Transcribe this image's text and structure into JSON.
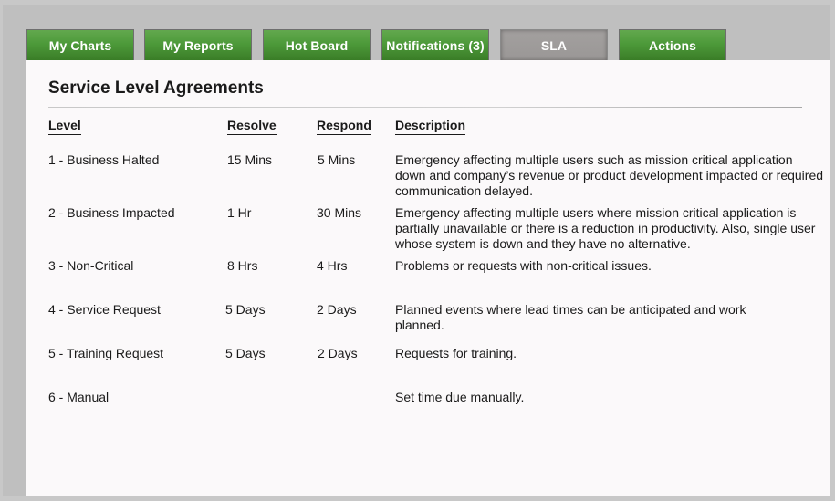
{
  "tabs": [
    {
      "label": "My Charts",
      "active": false
    },
    {
      "label": "My Reports",
      "active": false
    },
    {
      "label": "Hot Board",
      "active": false
    },
    {
      "label": "Notifications (3)",
      "active": false
    },
    {
      "label": "SLA",
      "active": true
    },
    {
      "label": "Actions",
      "active": false
    }
  ],
  "page": {
    "title": "Service Level Agreements"
  },
  "table": {
    "headers": {
      "level": "Level",
      "resolve": "Resolve",
      "respond": "Respond",
      "description": "Description"
    },
    "rows": [
      {
        "level": "1 - Business Halted",
        "resolve": "15 Mins",
        "respond": "5 Mins",
        "description": "Emergency affecting multiple users such as mission critical application down and company’s revenue or product development impacted or required communication delayed."
      },
      {
        "level": "2 - Business Impacted",
        "resolve": "1 Hr",
        "respond": "30 Mins",
        "description": "Emergency affecting multiple users where mission critical application is partially unavailable or there is a reduction in productivity. Also, single user whose system is down and they have no alternative."
      },
      {
        "level": "3 - Non-Critical",
        "resolve": "8 Hrs",
        "respond": "4 Hrs",
        "description": "Problems or requests with non-critical issues."
      },
      {
        "level": "4 - Service Request",
        "resolve": "5 Days",
        "respond": "2 Days",
        "description": "Planned events where lead times can be anticipated and work planned."
      },
      {
        "level": "5 - Training Request",
        "resolve": "5 Days",
        "respond": "2 Days",
        "description": "Requests for training."
      },
      {
        "level": "6 - Manual",
        "resolve": "",
        "respond": "",
        "description": "Set time due manually."
      }
    ]
  },
  "colors": {
    "tab_green": "#4d9a3a",
    "tab_active_gray": "#9f9c9b",
    "content_bg": "#fbf9fa",
    "frame_bg": "#bfbfbf"
  }
}
